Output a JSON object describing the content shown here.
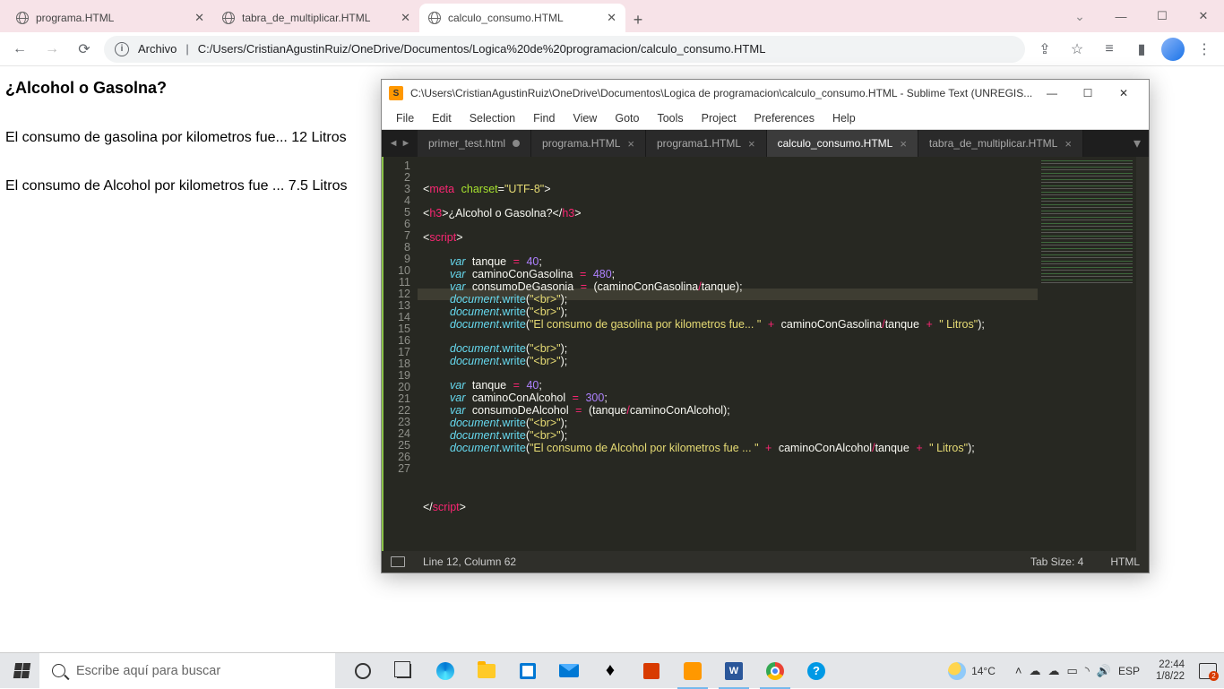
{
  "chrome": {
    "tabs": [
      {
        "title": "programa.HTML"
      },
      {
        "title": "tabra_de_multiplicar.HTML"
      },
      {
        "title": "calculo_consumo.HTML"
      }
    ],
    "active": 2,
    "url_label": "Archivo",
    "url": "C:/Users/CristianAgustinRuiz/OneDrive/Documentos/Logica%20de%20programacion/calculo_consumo.HTML"
  },
  "page": {
    "heading": "¿Alcohol o Gasolna?",
    "line1": "El consumo de gasolina por kilometros fue... 12 Litros",
    "line2": "El consumo de Alcohol por kilometros fue ... 7.5 Litros"
  },
  "sublime": {
    "title": "C:\\Users\\CristianAgustinRuiz\\OneDrive\\Documentos\\Logica de programacion\\calculo_consumo.HTML - Sublime Text (UNREGIS...",
    "menu": [
      "File",
      "Edit",
      "Selection",
      "Find",
      "View",
      "Goto",
      "Tools",
      "Project",
      "Preferences",
      "Help"
    ],
    "tabs": [
      {
        "name": "primer_test.html",
        "dirty": true
      },
      {
        "name": "programa.HTML"
      },
      {
        "name": "programa1.HTML"
      },
      {
        "name": "calculo_consumo.HTML",
        "active": true
      },
      {
        "name": "tabra_de_multiplicar.HTML"
      }
    ],
    "lines": 27,
    "status_pos": "Line 12, Column 62",
    "status_tab": "Tab Size: 4",
    "status_lang": "HTML"
  },
  "taskbar": {
    "search_placeholder": "Escribe aquí para buscar",
    "weather": "14°C",
    "lang": "ESP",
    "time": "22:44",
    "date": "1/8/22",
    "notif_count": "2"
  },
  "win": {
    "min": "—",
    "max": "☐",
    "close": "✕"
  }
}
